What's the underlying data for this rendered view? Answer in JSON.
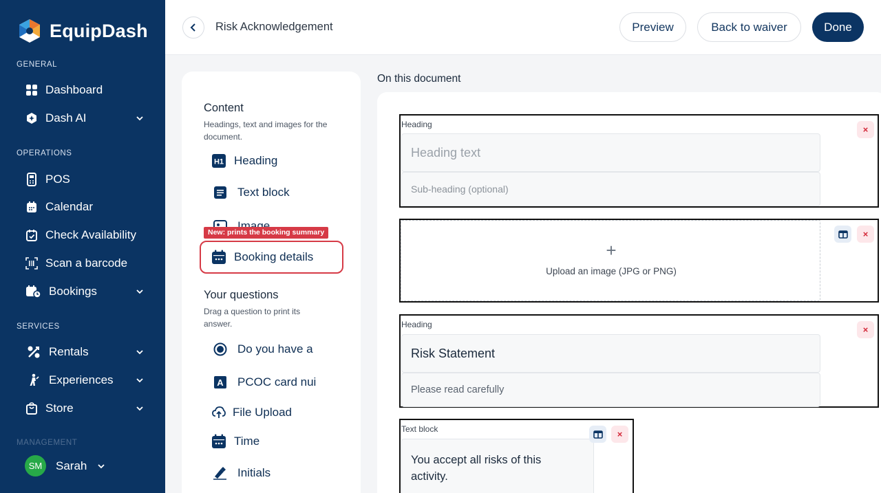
{
  "brand": {
    "name": "EquipDash"
  },
  "sidebar": {
    "sections": {
      "general": "GENERAL",
      "operations": "OPERATIONS",
      "services": "SERVICES",
      "management": "MANAGEMENT"
    },
    "items": [
      {
        "label": "Dashboard",
        "icon": "dashboard-icon"
      },
      {
        "label": "Dash AI",
        "icon": "dash-ai-icon"
      },
      {
        "label": "POS",
        "icon": "pos-icon"
      },
      {
        "label": "Calendar",
        "icon": "calendar-icon"
      },
      {
        "label": "Check Availability",
        "icon": "check-availability-icon"
      },
      {
        "label": "Scan a barcode",
        "icon": "barcode-icon"
      },
      {
        "label": "Bookings",
        "icon": "bookings-icon"
      },
      {
        "label": "Rentals",
        "icon": "rentals-icon"
      },
      {
        "label": "Experiences",
        "icon": "experiences-icon"
      },
      {
        "label": "Store",
        "icon": "store-icon"
      }
    ],
    "user": {
      "initials": "SM",
      "name": "Sarah"
    }
  },
  "topbar": {
    "title": "Risk Acknowledgement",
    "preview": "Preview",
    "back_to_waiver": "Back to waiver",
    "done": "Done"
  },
  "panel": {
    "content_title": "Content",
    "content_sub": "Headings, text and images for the document.",
    "content_items": {
      "heading": "Heading",
      "text_block": "Text block",
      "image": "Image",
      "booking_details": "Booking details"
    },
    "badge": "New: prints the booking summary",
    "questions_title": "Your questions",
    "questions_sub": "Drag a question to print its answer.",
    "question_items": {
      "q1": "Do you have a",
      "q2": "PCOC card nui",
      "file_upload": "File Upload",
      "time": "Time",
      "initials": "Initials"
    }
  },
  "document": {
    "title": "On this document",
    "blocks": {
      "b1": {
        "label": "Heading",
        "heading_placeholder": "Heading text",
        "sub_placeholder": "Sub-heading (optional)"
      },
      "b2": {
        "upload_plus": "+",
        "upload_label": "Upload an image (JPG or PNG)"
      },
      "b3": {
        "label": "Heading",
        "heading": "Risk Statement",
        "sub": "Please read carefully"
      },
      "b4": {
        "label": "Text block",
        "text": "You accept all risks of this activity."
      }
    },
    "delete_glyph": "×"
  },
  "colors": {
    "sidebar_bg": "#0b3463",
    "accent": "#0b3463",
    "danger": "#d63a46",
    "avatar": "#27a948"
  }
}
